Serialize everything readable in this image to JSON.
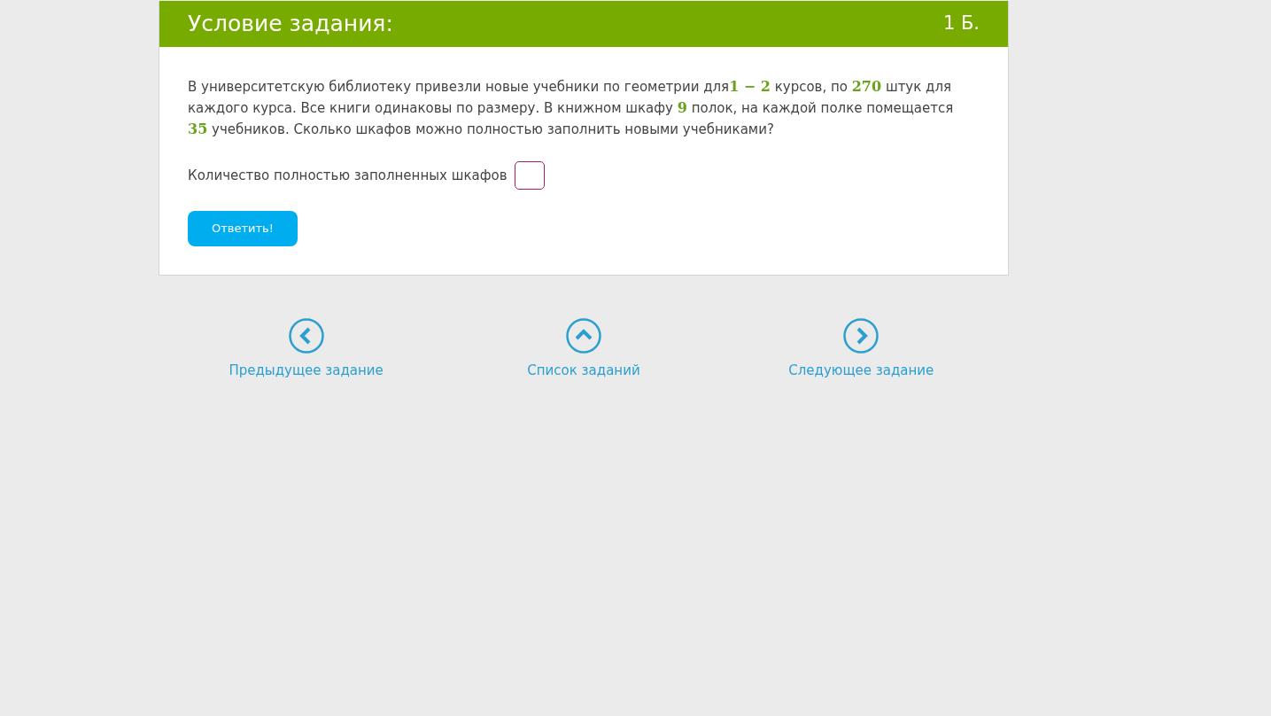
{
  "task": {
    "title": "Условие задания:",
    "points": "1 Б.",
    "statement": [
      {
        "kind": "text",
        "text": "В университетскую библиотеку привезли новые учебники по геометрии для"
      },
      {
        "kind": "math",
        "text": "1 − 2"
      },
      {
        "kind": "text",
        "text": " курсов, по "
      },
      {
        "kind": "math",
        "text": "270"
      },
      {
        "kind": "text",
        "text": " штук для каждого курса. Все книги одинаковы по размеру. В книжном шкафу "
      },
      {
        "kind": "math",
        "text": "9"
      },
      {
        "kind": "text",
        "text": " полок, на каждой полке помещается "
      },
      {
        "kind": "math",
        "text": "35"
      },
      {
        "kind": "text",
        "text": " учебников. Сколько шкафов можно полностью заполнить новыми учебниками?"
      }
    ],
    "answer_label": "Количество полностью заполненных шкафов",
    "submit": "Ответить!"
  },
  "navigation": [
    {
      "kind": "prev",
      "label": "Предыдущее задание"
    },
    {
      "kind": "list",
      "label": "Список заданий"
    },
    {
      "kind": "next",
      "label": "Следующее задание"
    }
  ]
}
